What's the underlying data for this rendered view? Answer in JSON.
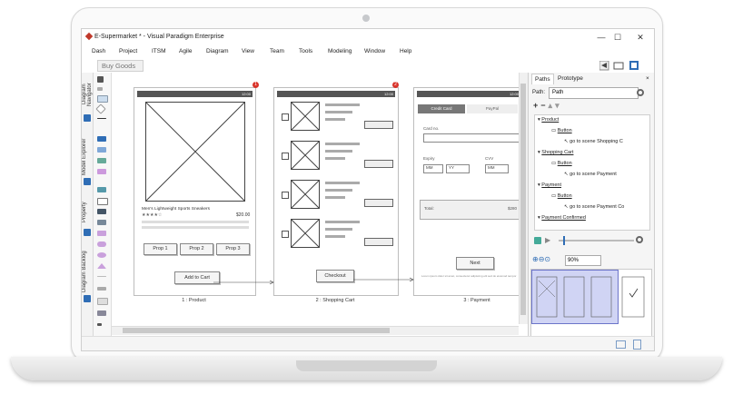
{
  "window": {
    "title": "E-Supermarket * - Visual Paradigm Enterprise",
    "minimize": "—",
    "maximize": "☐",
    "close": "✕"
  },
  "menu": [
    "Dash",
    "Project",
    "ITSM",
    "Agile",
    "Diagram",
    "View",
    "Team",
    "Tools",
    "Modeling",
    "Window",
    "Help"
  ],
  "breadcrumb": "Buy Goods",
  "side_tabs": [
    "Diagram Navigator",
    "Model Explorer",
    "Property",
    "Diagram Backlog"
  ],
  "scenes": [
    {
      "caption": "1 : Product",
      "badge": "1",
      "status_time": "12:00",
      "product_name": "Men's Lightweight Sports Sneakers",
      "rating": "★★★★☆",
      "price": "$20.00",
      "props": [
        "Prop 1",
        "Prop 2",
        "Prop 3"
      ],
      "action": "Add to Cart"
    },
    {
      "caption": "2 : Shopping Cart",
      "badge": "2",
      "status_time": "12:00",
      "action": "Checkout"
    },
    {
      "caption": "3 : Payment",
      "status_time": "12:00",
      "tabs": [
        "Credit Card",
        "PayPal"
      ],
      "card_label": "Card no.",
      "expiry_label": "Expiry",
      "cvv_label": "CVV",
      "mm": "MM",
      "yy": "YY",
      "cvv_mm": "MM",
      "total_label": "Total:",
      "total_value": "$280",
      "action": "Next",
      "footnote": "Lorem ipsum dolor sit amet, consectetur adipiscing elit sed do eiusmod tempor"
    }
  ],
  "panel": {
    "tabs": [
      "Paths",
      "Prototype"
    ],
    "path_label": "Path:",
    "path_value": "Path",
    "tree": [
      {
        "label": "Product",
        "level": 0
      },
      {
        "label": "Button",
        "level": 1
      },
      {
        "label": "go to scene Shopping C",
        "level": 2
      },
      {
        "label": "Shopping Cart",
        "level": 0
      },
      {
        "label": "Button",
        "level": 1
      },
      {
        "label": "go to scene Payment",
        "level": 2
      },
      {
        "label": "Payment",
        "level": 0
      },
      {
        "label": "Button",
        "level": 1
      },
      {
        "label": "go to scene Payment Co",
        "level": 2
      },
      {
        "label": "Payment Confirmed",
        "level": 0
      }
    ],
    "zoom": "90%"
  }
}
